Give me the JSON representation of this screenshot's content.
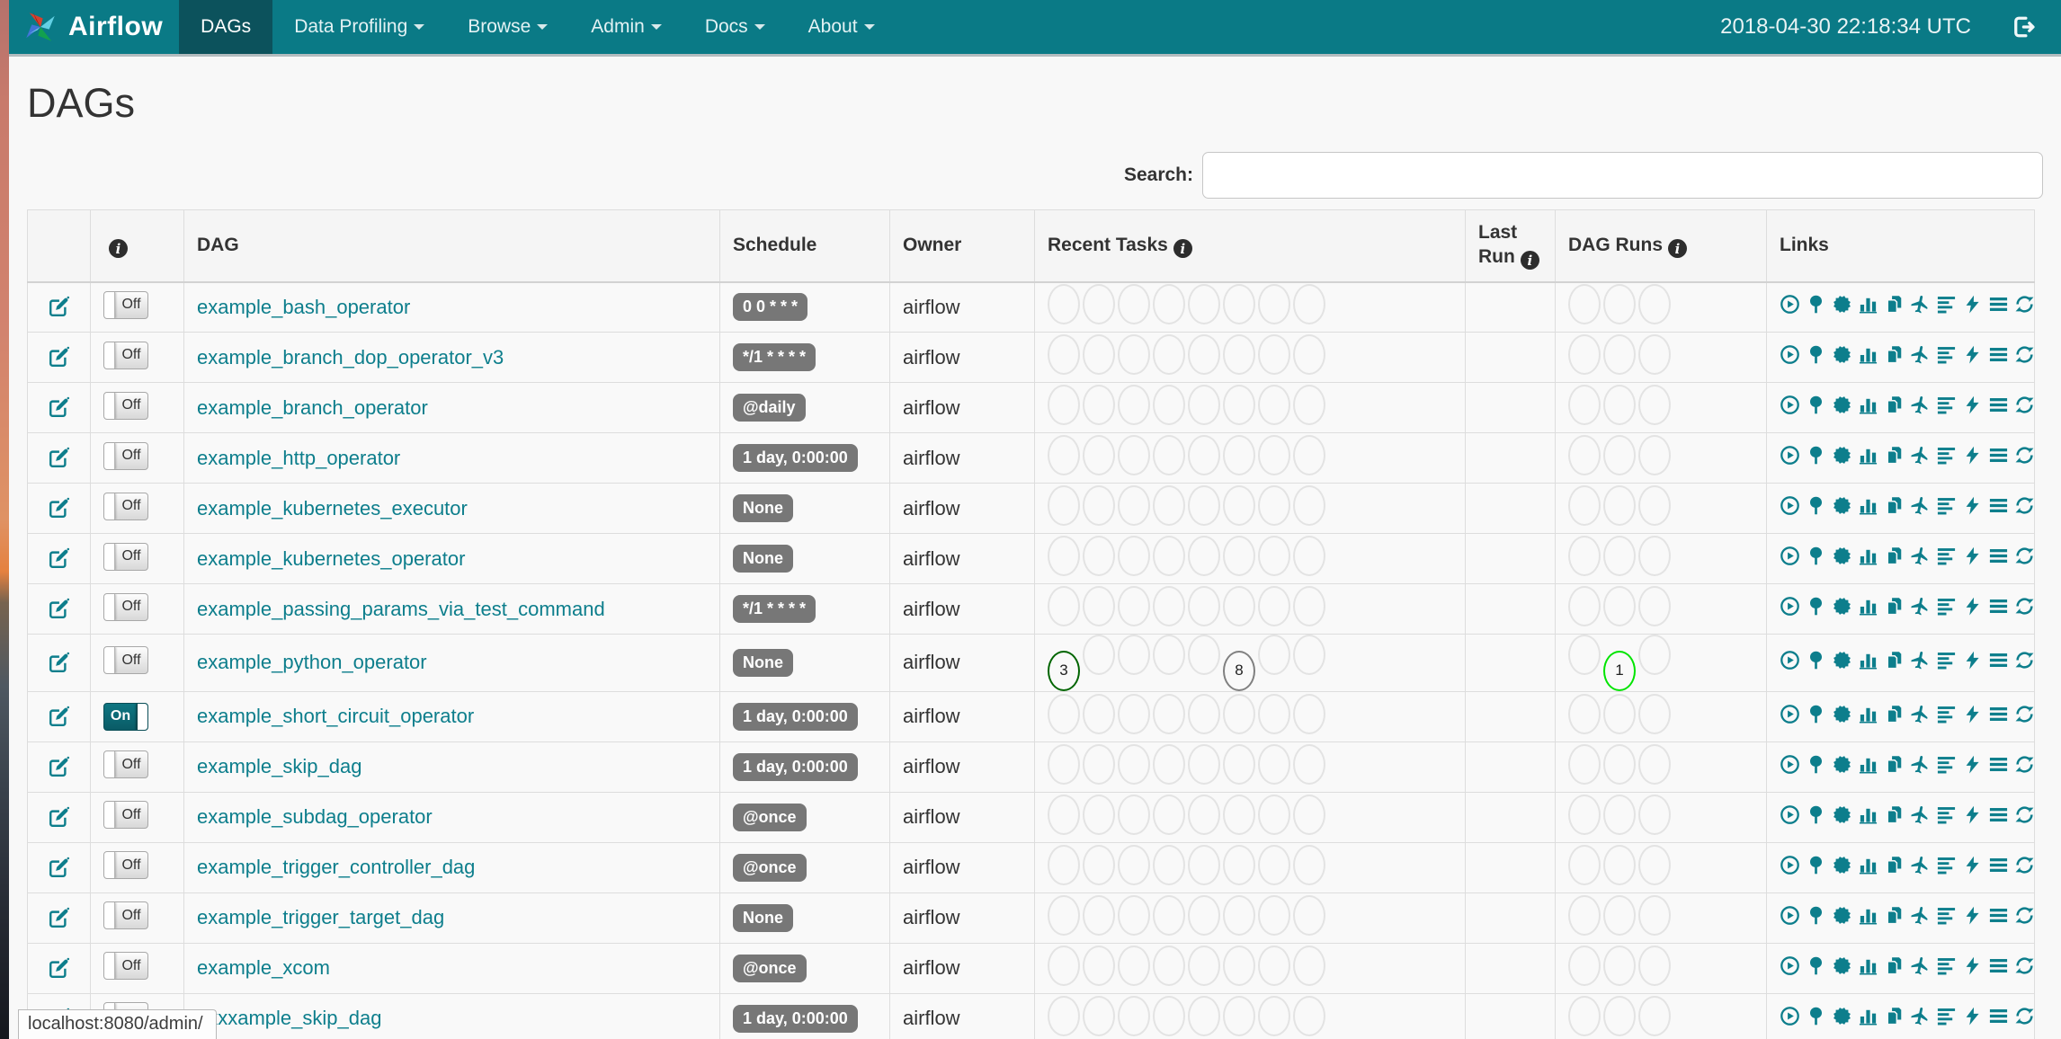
{
  "navbar": {
    "brand": "Airflow",
    "items": [
      {
        "label": "DAGs",
        "active": true,
        "dropdown": false
      },
      {
        "label": "Data Profiling",
        "active": false,
        "dropdown": true
      },
      {
        "label": "Browse",
        "active": false,
        "dropdown": true
      },
      {
        "label": "Admin",
        "active": false,
        "dropdown": true
      },
      {
        "label": "Docs",
        "active": false,
        "dropdown": true
      },
      {
        "label": "About",
        "active": false,
        "dropdown": true
      }
    ],
    "clock": "2018-04-30 22:18:34 UTC",
    "logout_icon": "log-out-icon"
  },
  "page": {
    "title": "DAGs"
  },
  "search": {
    "label": "Search:",
    "value": "",
    "placeholder": ""
  },
  "status_bar": "localhost:8080/admin/",
  "table": {
    "headers": [
      {
        "label": "",
        "key": "edit",
        "info_icon": false
      },
      {
        "label": "",
        "key": "toggle",
        "info_icon": true
      },
      {
        "label": "DAG",
        "key": "dag",
        "info_icon": false
      },
      {
        "label": "Schedule",
        "key": "schedule",
        "info_icon": false
      },
      {
        "label": "Owner",
        "key": "owner",
        "info_icon": false
      },
      {
        "label": "Recent Tasks",
        "key": "recent_tasks",
        "info_icon": true
      },
      {
        "label": "Last Run",
        "key": "last_run",
        "info_icon": true
      },
      {
        "label": "DAG Runs",
        "key": "dag_runs",
        "info_icon": true
      },
      {
        "label": "Links",
        "key": "links",
        "info_icon": false
      }
    ],
    "recent_tasks_slots": 8,
    "dag_runs_slots": 3,
    "link_icons": [
      "trigger-dag",
      "tree-view",
      "graph-view",
      "task-duration",
      "task-tries",
      "landing-times",
      "gantt",
      "code",
      "logs",
      "refresh"
    ],
    "rows": [
      {
        "toggle": "Off",
        "dag": "example_bash_operator",
        "schedule": "0 0 * * *",
        "owner": "airflow",
        "last_run": "",
        "recent_tasks": [],
        "dag_runs": []
      },
      {
        "toggle": "Off",
        "dag": "example_branch_dop_operator_v3",
        "schedule": "*/1 * * * *",
        "owner": "airflow",
        "last_run": "",
        "recent_tasks": [],
        "dag_runs": []
      },
      {
        "toggle": "Off",
        "dag": "example_branch_operator",
        "schedule": "@daily",
        "owner": "airflow",
        "last_run": "",
        "recent_tasks": [],
        "dag_runs": []
      },
      {
        "toggle": "Off",
        "dag": "example_http_operator",
        "schedule": "1 day, 0:00:00",
        "owner": "airflow",
        "last_run": "",
        "recent_tasks": [],
        "dag_runs": []
      },
      {
        "toggle": "Off",
        "dag": "example_kubernetes_executor",
        "schedule": "None",
        "owner": "airflow",
        "last_run": "",
        "recent_tasks": [],
        "dag_runs": []
      },
      {
        "toggle": "Off",
        "dag": "example_kubernetes_operator",
        "schedule": "None",
        "owner": "airflow",
        "last_run": "",
        "recent_tasks": [],
        "dag_runs": []
      },
      {
        "toggle": "Off",
        "dag": "example_passing_params_via_test_command",
        "schedule": "*/1 * * * *",
        "owner": "airflow",
        "last_run": "",
        "recent_tasks": [],
        "dag_runs": []
      },
      {
        "toggle": "Off",
        "dag": "example_python_operator",
        "schedule": "None",
        "owner": "airflow",
        "last_run": "",
        "recent_tasks": [
          {
            "slot": 1,
            "count": 3,
            "state": "success",
            "color": "#006400"
          },
          {
            "slot": 6,
            "count": 8,
            "state": "queued",
            "color": "#808080"
          }
        ],
        "dag_runs": [
          {
            "slot": 2,
            "count": 1,
            "state": "running",
            "color": "#00e400"
          }
        ]
      },
      {
        "toggle": "On",
        "dag": "example_short_circuit_operator",
        "schedule": "1 day, 0:00:00",
        "owner": "airflow",
        "last_run": "",
        "recent_tasks": [],
        "dag_runs": []
      },
      {
        "toggle": "Off",
        "dag": "example_skip_dag",
        "schedule": "1 day, 0:00:00",
        "owner": "airflow",
        "last_run": "",
        "recent_tasks": [],
        "dag_runs": []
      },
      {
        "toggle": "Off",
        "dag": "example_subdag_operator",
        "schedule": "@once",
        "owner": "airflow",
        "last_run": "",
        "recent_tasks": [],
        "dag_runs": []
      },
      {
        "toggle": "Off",
        "dag": "example_trigger_controller_dag",
        "schedule": "@once",
        "owner": "airflow",
        "last_run": "",
        "recent_tasks": [],
        "dag_runs": []
      },
      {
        "toggle": "Off",
        "dag": "example_trigger_target_dag",
        "schedule": "None",
        "owner": "airflow",
        "last_run": "",
        "recent_tasks": [],
        "dag_runs": []
      },
      {
        "toggle": "Off",
        "dag": "example_xcom",
        "schedule": "@once",
        "owner": "airflow",
        "last_run": "",
        "recent_tasks": [],
        "dag_runs": []
      },
      {
        "toggle": "Off",
        "dag": "exxxample_skip_dag",
        "schedule": "1 day, 0:00:00",
        "owner": "airflow",
        "last_run": "",
        "recent_tasks": [],
        "dag_runs": []
      }
    ]
  },
  "colors": {
    "navbar_bg": "#0a7a86",
    "navbar_active_bg": "#0c525c",
    "accent_teal": "#0d7e8c",
    "badge_bg": "#777777",
    "state_success": "#006400",
    "state_queued": "#808080",
    "state_running": "#00e400"
  }
}
